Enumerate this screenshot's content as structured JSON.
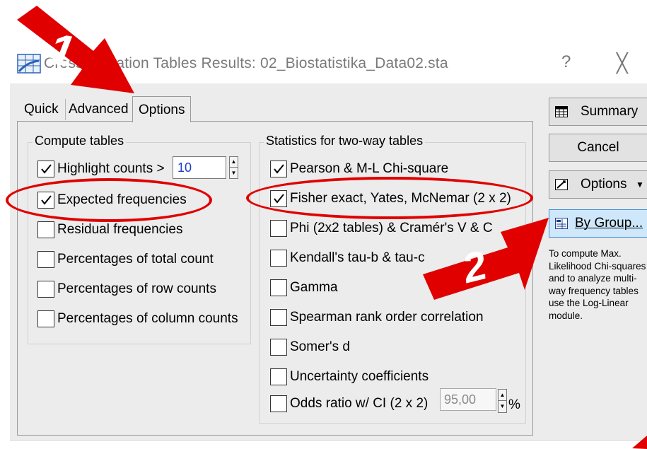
{
  "window": {
    "title": "Crosstabulation Tables Results: 02_Biostatistika_Data02.sta",
    "help_glyph": "?",
    "close_glyph": "╳"
  },
  "tabs": [
    {
      "label": "Quick",
      "active": false
    },
    {
      "label": "Advanced",
      "active": false
    },
    {
      "label": "Options",
      "active": true
    }
  ],
  "compute_tables": {
    "title": "Compute tables",
    "highlight": {
      "label": "Highlight counts >",
      "checked": true,
      "value": "10"
    },
    "items": [
      {
        "label": "Expected frequencies",
        "checked": true
      },
      {
        "label": "Residual frequencies",
        "checked": false
      },
      {
        "label": "Percentages of total count",
        "checked": false
      },
      {
        "label": "Percentages of row counts",
        "checked": false
      },
      {
        "label": "Percentages of column counts",
        "checked": false
      }
    ]
  },
  "two_way": {
    "title": "Statistics for two-way tables",
    "items": [
      {
        "label": "Pearson & M-L Chi-square",
        "checked": true
      },
      {
        "label": "Fisher exact, Yates, McNemar (2 x 2)",
        "checked": true
      },
      {
        "label": "Phi (2x2 tables) & Cramér's V &  C",
        "checked": false
      },
      {
        "label": "Kendall's tau-b & tau-c",
        "checked": false
      },
      {
        "label": "Gamma",
        "checked": false
      },
      {
        "label": "Spearman rank order correlation",
        "checked": false
      },
      {
        "label": "Somer's d",
        "checked": false
      },
      {
        "label": "Uncertainty coefficients",
        "checked": false
      }
    ],
    "odds": {
      "label": "Odds ratio w/ CI (2 x 2)",
      "checked": false,
      "value": "95,00",
      "unit": "%"
    }
  },
  "buttons": {
    "summary": "Summary",
    "cancel": "Cancel",
    "options": "Options",
    "options_caret": "▼",
    "by_group": "By Group..."
  },
  "note": "To compute Max. Likelihood Chi-squares and to analyze multi-way frequency tables use the Log-Linear module.",
  "annotations": {
    "step1": "1",
    "step2": "2",
    "color": "#e00000"
  }
}
